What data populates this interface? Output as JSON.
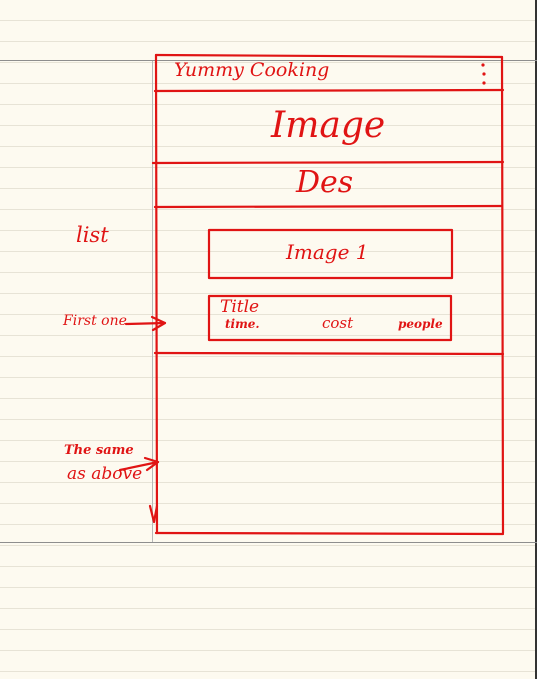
{
  "ink_color": "#e01414",
  "mockup": {
    "app_title": "Yummy Cooking",
    "menu_icon": "vertical-ellipsis-icon",
    "header_image_label": "Image",
    "description_label": "Des",
    "list_card": {
      "image_label": "Image 1",
      "title_label": "Title",
      "meta": [
        "time.",
        "cost",
        "people"
      ]
    }
  },
  "annotations": {
    "list_label": "list",
    "first_one": "First one",
    "same_as_above": [
      "The same",
      "as above"
    ]
  }
}
